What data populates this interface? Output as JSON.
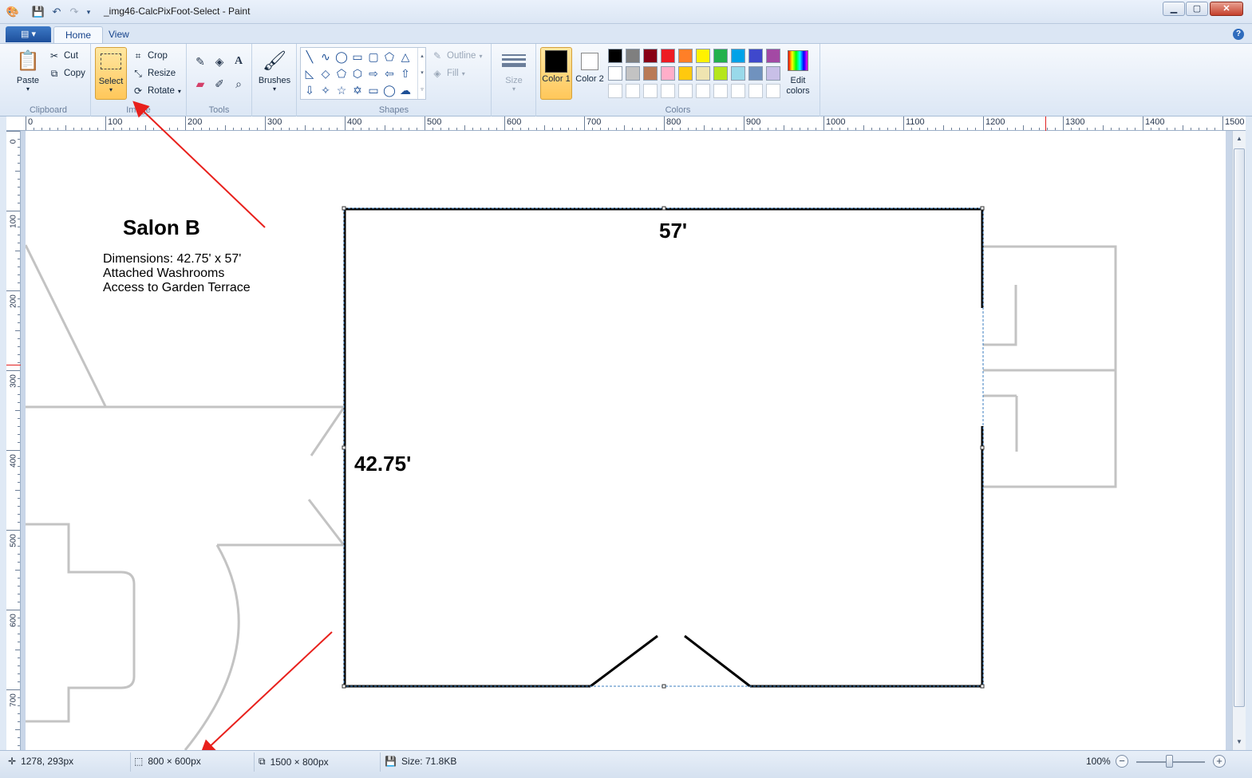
{
  "window": {
    "title": "_img46-CalcPixFoot-Select - Paint",
    "minimize": "▁",
    "maximize": "▢",
    "close": "✕"
  },
  "tabs": [
    {
      "label": "Home",
      "active": true
    },
    {
      "label": "View",
      "active": false
    }
  ],
  "help_label": "?",
  "ribbon": {
    "clipboard": {
      "group_label": "Clipboard",
      "paste": "Paste",
      "cut": "Cut",
      "copy": "Copy"
    },
    "image": {
      "group_label": "Image",
      "select": "Select",
      "crop": "Crop",
      "resize": "Resize",
      "rotate": "Rotate"
    },
    "tools": {
      "group_label": "Tools"
    },
    "brushes": {
      "label": "Brushes"
    },
    "shapes": {
      "group_label": "Shapes",
      "outline": "Outline",
      "fill": "Fill"
    },
    "size": {
      "label": "Size"
    },
    "colors": {
      "group_label": "Colors",
      "color1": "Color 1",
      "color2": "Color 2",
      "edit_colors": "Edit colors",
      "color1_value": "#000000",
      "color2_value": "#ffffff",
      "palette_row1": [
        "#000000",
        "#7f7f7f",
        "#880015",
        "#ed1c24",
        "#ff7f27",
        "#fff200",
        "#22b14c",
        "#00a2e8",
        "#3f48cc",
        "#a349a4"
      ],
      "palette_row2": [
        "#ffffff",
        "#c3c3c3",
        "#b97a57",
        "#ffaec9",
        "#ffc90e",
        "#efe4b0",
        "#b5e61d",
        "#99d9ea",
        "#7092be",
        "#c8bfe7"
      ],
      "palette_row3": [
        "#ffffff",
        "#ffffff",
        "#ffffff",
        "#ffffff",
        "#ffffff",
        "#ffffff",
        "#ffffff",
        "#ffffff",
        "#ffffff",
        "#ffffff"
      ]
    }
  },
  "rulers": {
    "h_labels": [
      "0",
      "100",
      "200",
      "300",
      "400",
      "500",
      "600",
      "700",
      "800",
      "900",
      "1000",
      "1100",
      "1200",
      "1300",
      "1400",
      "1500"
    ],
    "v_labels": [
      "0",
      "100",
      "200",
      "300",
      "400",
      "500",
      "600",
      "700"
    ]
  },
  "drawing": {
    "room_title": "Salon B",
    "details": [
      "Dimensions: 42.75' x 57'",
      "Attached Washrooms",
      "Access to Garden Terrace"
    ],
    "width_label": "57'",
    "height_label": "42.75'"
  },
  "status": {
    "cursor_position": "1278, 293px",
    "selection_size": "800 × 600px",
    "canvas_size": "1500 × 800px",
    "file_size": "Size: 71.8KB",
    "zoom": "100%"
  },
  "annotation_color": "#e8201c"
}
